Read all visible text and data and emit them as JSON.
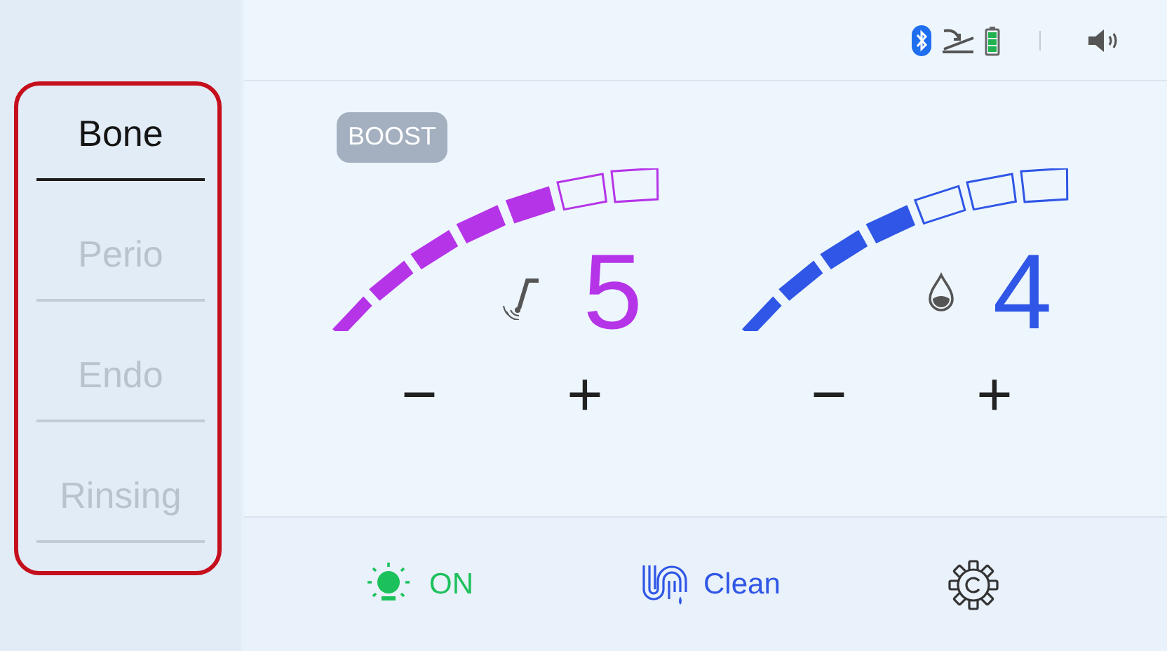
{
  "modes": [
    {
      "label": "Bone",
      "selected": true
    },
    {
      "label": "Perio",
      "selected": false
    },
    {
      "label": "Endo",
      "selected": false
    },
    {
      "label": "Rinsing",
      "selected": false
    }
  ],
  "boost": {
    "label": "BOOST"
  },
  "gauges": [
    {
      "kind": "power",
      "value": "5",
      "level": 0.714,
      "color": "#b534e8",
      "minus": "−",
      "plus": "+"
    },
    {
      "kind": "water",
      "value": "4",
      "level": 0.571,
      "color": "#2f56e6",
      "minus": "−",
      "plus": "+"
    }
  ],
  "bottom_bar": [
    {
      "kind": "light",
      "label": "ON",
      "on": true
    },
    {
      "kind": "clean",
      "label": "Clean"
    },
    {
      "kind": "settings"
    }
  ]
}
